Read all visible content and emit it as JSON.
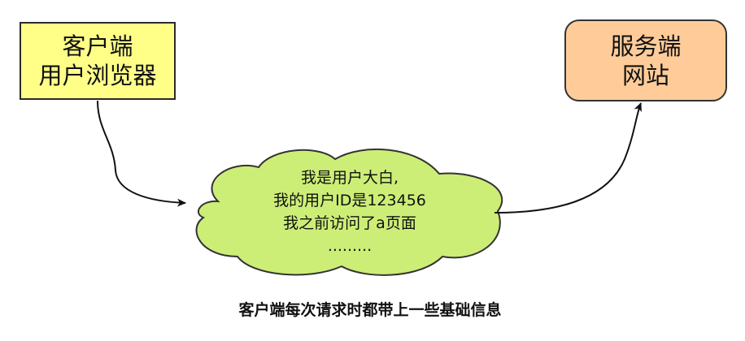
{
  "client_box": {
    "line1": "客户端",
    "line2": "用户浏览器",
    "fill_color": "#ffff88"
  },
  "server_box": {
    "line1": "服务端",
    "line2": "网站",
    "fill_color": "#ffcc99"
  },
  "cloud": {
    "lines": [
      "我是用户大白,",
      "我的用户ID是123456",
      "我之前访问了a页面",
      "........."
    ],
    "fill_color": "#ccee77"
  },
  "caption": "客户端每次请求时都带上一些基础信息"
}
